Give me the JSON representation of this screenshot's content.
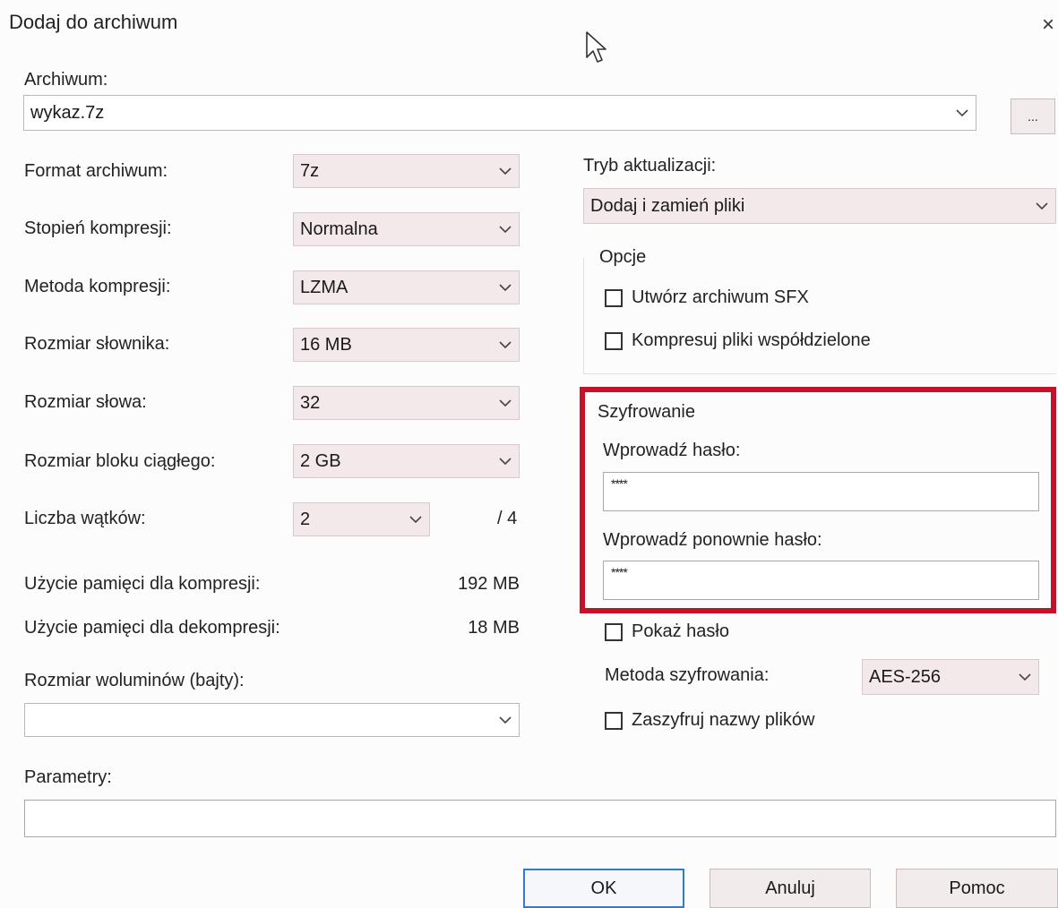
{
  "window": {
    "title": "Dodaj do archiwum",
    "close_glyph": "×"
  },
  "archive": {
    "label": "Archiwum:",
    "value": "wykaz.7z",
    "browse_label": "..."
  },
  "left": {
    "format": {
      "label": "Format archiwum:",
      "value": "7z"
    },
    "level": {
      "label": "Stopień kompresji:",
      "value": "Normalna"
    },
    "method": {
      "label": "Metoda kompresji:",
      "value": "LZMA"
    },
    "dict": {
      "label": "Rozmiar słownika:",
      "value": "16 MB"
    },
    "word": {
      "label": "Rozmiar słowa:",
      "value": "32"
    },
    "block": {
      "label": "Rozmiar bloku ciągłego:",
      "value": "2 GB"
    },
    "threads": {
      "label": "Liczba wątków:",
      "value": "2",
      "max": "/ 4"
    },
    "mem_comp": {
      "label": "Użycie pamięci dla kompresji:",
      "value": "192 MB"
    },
    "mem_decomp": {
      "label": "Użycie pamięci dla dekompresji:",
      "value": "18 MB"
    },
    "volumes": {
      "label": "Rozmiar woluminów (bajty):",
      "value": ""
    }
  },
  "right": {
    "update": {
      "label": "Tryb aktualizacji:",
      "value": "Dodaj i zamień pliki"
    },
    "options": {
      "title": "Opcje",
      "sfx": {
        "label": "Utwórz archiwum SFX",
        "checked": false
      },
      "shared": {
        "label": "Kompresuj pliki współdzielone",
        "checked": false
      }
    },
    "encryption": {
      "title": "Szyfrowanie",
      "password_label": "Wprowadź hasło:",
      "password_value": "****",
      "repeat_label": "Wprowadź ponownie hasło:",
      "repeat_value": "****",
      "show_password": {
        "label": "Pokaż hasło",
        "checked": false
      },
      "method": {
        "label": "Metoda szyfrowania:",
        "value": "AES-256"
      },
      "encrypt_names": {
        "label": "Zaszyfruj nazwy plików",
        "checked": false
      }
    }
  },
  "params": {
    "label": "Parametry:",
    "value": ""
  },
  "buttons": {
    "ok": "OK",
    "cancel": "Anuluj",
    "help": "Pomoc"
  },
  "colors": {
    "highlight": "#c4122b",
    "default_button_border": "#2f7bd4",
    "combo_shade": "#f4e9ea"
  },
  "icons": {
    "dropdown": "chevron-down-icon",
    "close": "close-icon",
    "cursor": "mouse-cursor-icon"
  }
}
